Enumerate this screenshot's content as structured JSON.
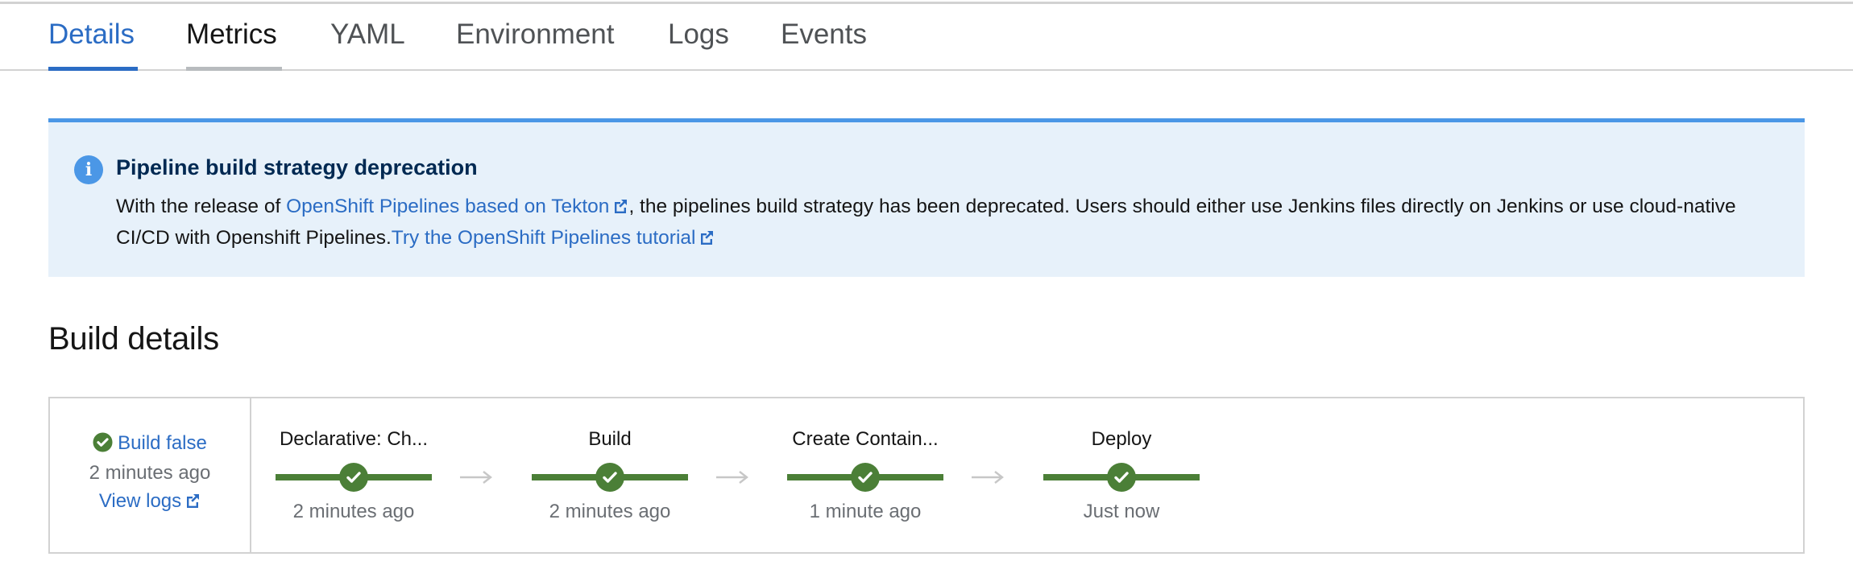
{
  "tabs": [
    {
      "label": "Details",
      "state": "active"
    },
    {
      "label": "Metrics",
      "state": "hover"
    },
    {
      "label": "YAML",
      "state": "normal"
    },
    {
      "label": "Environment",
      "state": "normal"
    },
    {
      "label": "Logs",
      "state": "normal"
    },
    {
      "label": "Events",
      "state": "normal"
    }
  ],
  "alert": {
    "type": "info",
    "icon": "info-circle-icon",
    "title": "Pipeline build strategy deprecation",
    "body_prefix": "With the release of ",
    "link1": "OpenShift Pipelines based on Tekton",
    "body_middle": ", the pipelines build strategy has been deprecated. Users should either use Jenkins files directly on Jenkins or use cloud-native CI/CD with Openshift Pipelines.",
    "link2": "Try the OpenShift Pipelines tutorial"
  },
  "section": {
    "title": "Build details"
  },
  "build": {
    "name": "Build false",
    "status": "success",
    "time": "2 minutes ago",
    "logs_label": "View logs"
  },
  "stages": [
    {
      "name": "Declarative: Ch...",
      "time": "2 minutes ago",
      "status": "success"
    },
    {
      "name": "Build",
      "time": "2 minutes ago",
      "status": "success"
    },
    {
      "name": "Create Contain...",
      "time": "1 minute ago",
      "status": "success"
    },
    {
      "name": "Deploy",
      "time": "Just now",
      "status": "success"
    }
  ],
  "colors": {
    "accent": "#2b6cc4",
    "success": "#4b7f37",
    "info": "#4b97e6",
    "alert_bg": "#e7f1fa"
  }
}
